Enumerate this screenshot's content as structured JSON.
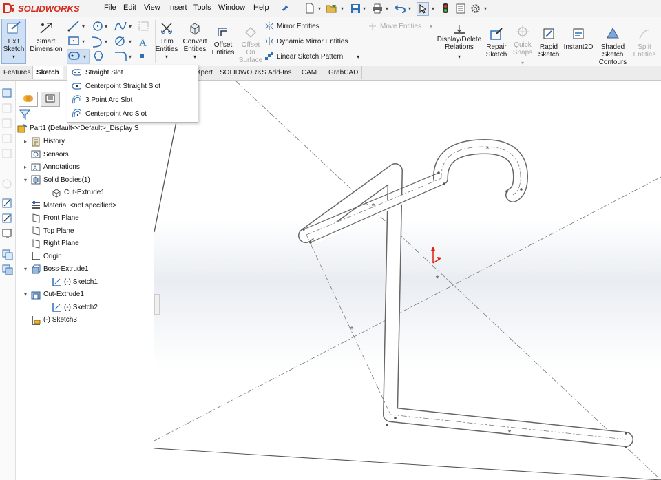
{
  "app": {
    "logo_text": "SOLIDWORKS",
    "brand_color": "#d52b1e"
  },
  "menubar": {
    "items": [
      "File",
      "Edit",
      "View",
      "Insert",
      "Tools",
      "Window",
      "Help"
    ]
  },
  "ribbon": {
    "exit_sketch": [
      "Exit",
      "Sketch"
    ],
    "smart_dimension": [
      "Smart",
      "Dimension"
    ],
    "trim_entities": [
      "Trim",
      "Entities"
    ],
    "convert_entities": [
      "Convert",
      "Entities"
    ],
    "offset_entities": [
      "Offset",
      "Entities"
    ],
    "offset_on_surface": [
      "Offset",
      "On",
      "Surface"
    ],
    "mirror_entities": "Mirror Entities",
    "dynamic_mirror_entities": "Dynamic Mirror Entities",
    "linear_sketch_pattern": "Linear Sketch Pattern",
    "move_entities": "Move Entities",
    "display_delete_relations": [
      "Display/Delete",
      "Relations"
    ],
    "repair_sketch": [
      "Repair",
      "Sketch"
    ],
    "quick_snaps": [
      "Quick",
      "Snaps"
    ],
    "rapid_sketch": [
      "Rapid",
      "Sketch"
    ],
    "instant2d": "Instant2D",
    "shaded_sketch_contours": [
      "Shaded",
      "Sketch",
      "Contours"
    ],
    "split_entities": [
      "Split",
      "Entities"
    ]
  },
  "tabs": [
    {
      "label": "Features",
      "active": false
    },
    {
      "label": "Sketch",
      "active": true
    },
    {
      "label": "Xpert",
      "active": false
    },
    {
      "label": "SOLIDWORKS Add-Ins",
      "active": false
    },
    {
      "label": "CAM",
      "active": false
    },
    {
      "label": "GrabCAD",
      "active": false
    }
  ],
  "slot_menu": {
    "items": [
      "Straight Slot",
      "Centerpoint Straight Slot",
      "3 Point Arc Slot",
      "Centerpoint Arc Slot"
    ]
  },
  "feature_tree": {
    "root": "Part1  (Default<<Default>_Display S",
    "items": [
      {
        "label": "History",
        "icon": "history-icon",
        "expander": "collapsed"
      },
      {
        "label": "Sensors",
        "icon": "sensor-icon",
        "expander": "none"
      },
      {
        "label": "Annotations",
        "icon": "annotations-icon",
        "expander": "collapsed"
      },
      {
        "label": "Solid Bodies(1)",
        "icon": "solid-bodies-icon",
        "expander": "expanded"
      },
      {
        "label": "Cut-Extrude1",
        "icon": "solid-body-icon",
        "expander": "none"
      },
      {
        "label": "Material <not specified>",
        "icon": "material-icon",
        "expander": "none"
      },
      {
        "label": "Front Plane",
        "icon": "plane-icon",
        "expander": "none"
      },
      {
        "label": "Top Plane",
        "icon": "plane-icon",
        "expander": "none"
      },
      {
        "label": "Right Plane",
        "icon": "plane-icon",
        "expander": "none"
      },
      {
        "label": "Origin",
        "icon": "origin-icon",
        "expander": "none"
      },
      {
        "label": "Boss-Extrude1",
        "icon": "boss-extrude-icon",
        "expander": "expanded"
      },
      {
        "label": "(-) Sketch1",
        "icon": "sketch-icon",
        "expander": "none"
      },
      {
        "label": "Cut-Extrude1",
        "icon": "cut-extrude-icon",
        "expander": "expanded"
      },
      {
        "label": "(-) Sketch2",
        "icon": "sketch-icon",
        "expander": "none"
      },
      {
        "label": "(-) Sketch3",
        "icon": "sketch-active-icon",
        "expander": "none"
      }
    ]
  }
}
